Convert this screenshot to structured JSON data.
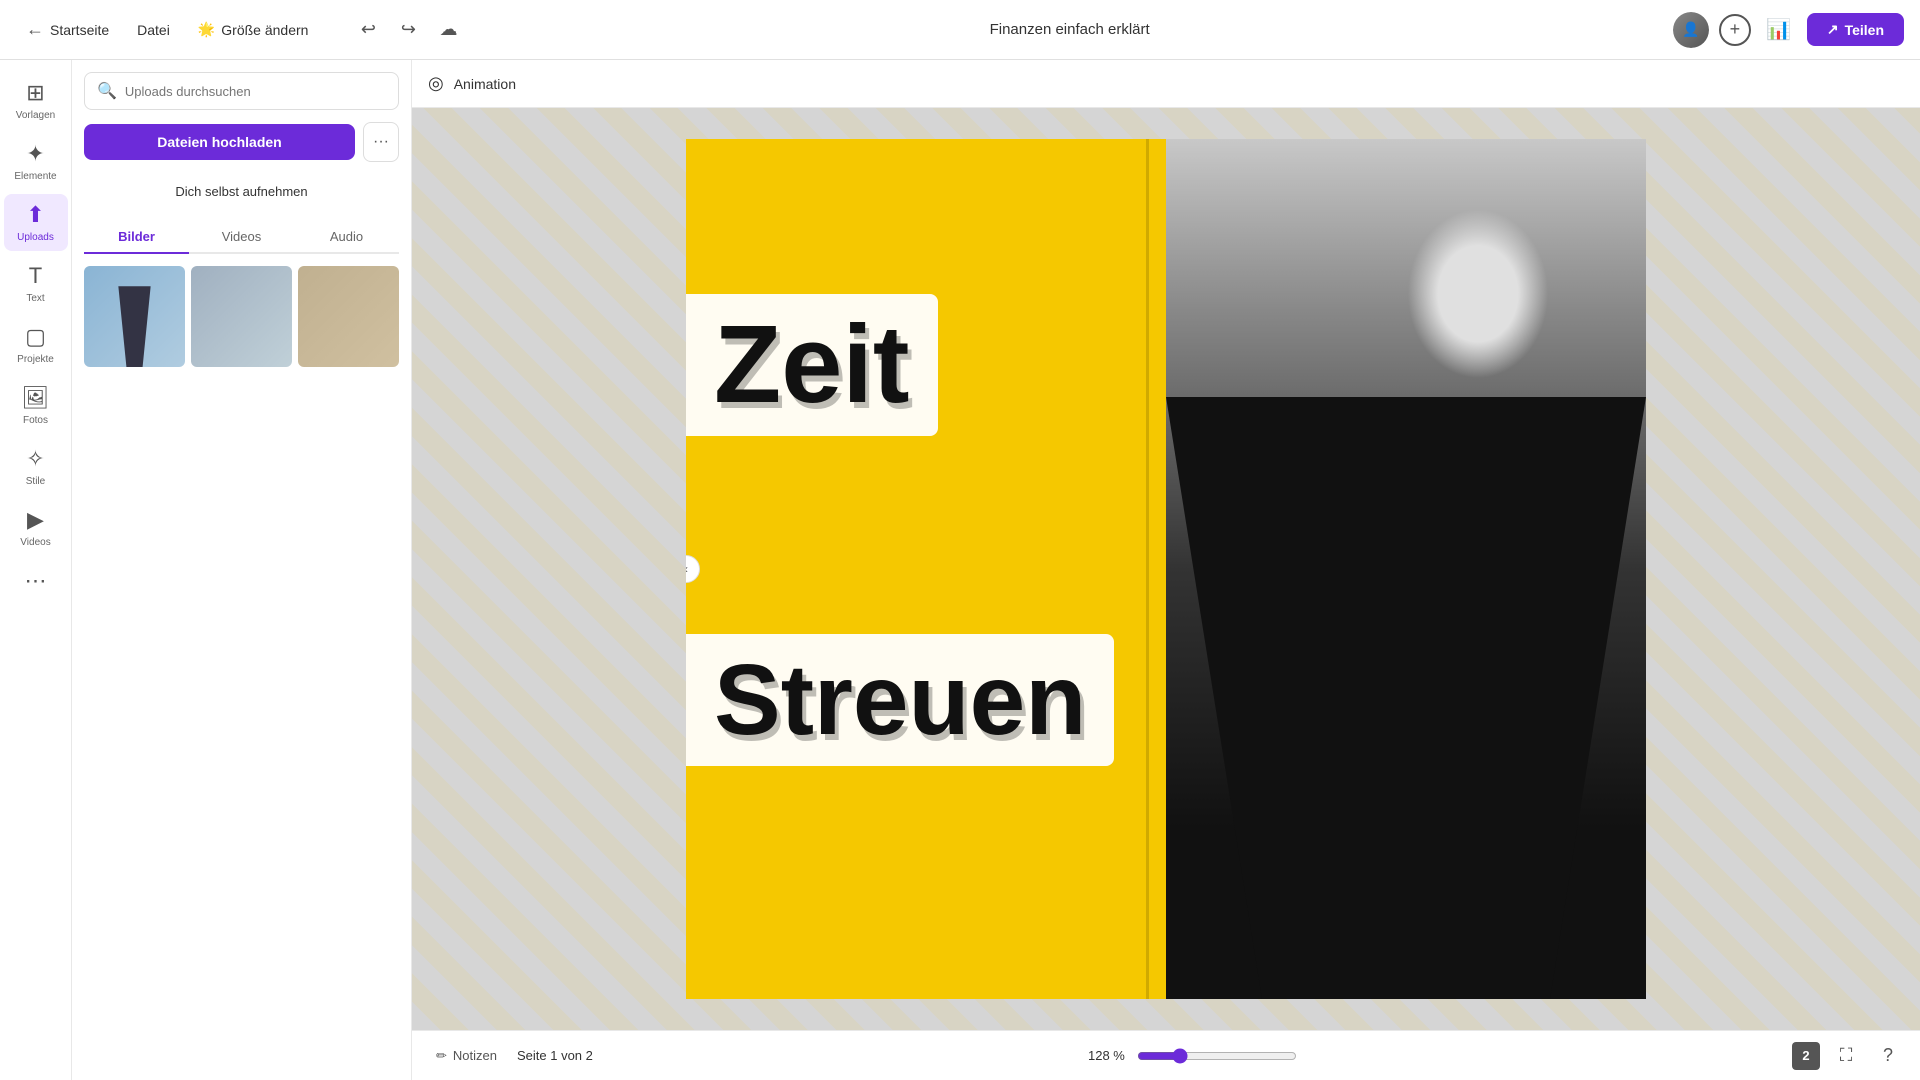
{
  "topbar": {
    "back_label": "Startseite",
    "file_label": "Datei",
    "resize_label": "Größe ändern",
    "title": "Finanzen einfach erklärt",
    "share_label": "Teilen"
  },
  "sidebar": {
    "items": [
      {
        "id": "vorlagen",
        "label": "Vorlagen",
        "icon": "⊞"
      },
      {
        "id": "elemente",
        "label": "Elemente",
        "icon": "✦"
      },
      {
        "id": "uploads",
        "label": "Uploads",
        "icon": "⬆",
        "active": true
      },
      {
        "id": "text",
        "label": "Text",
        "icon": "T"
      },
      {
        "id": "projekte",
        "label": "Projekte",
        "icon": "▢"
      },
      {
        "id": "fotos",
        "label": "Fotos",
        "icon": "🖼"
      },
      {
        "id": "stile",
        "label": "Stile",
        "icon": "✧"
      },
      {
        "id": "videos",
        "label": "Videos",
        "icon": "▶"
      },
      {
        "id": "more",
        "label": "",
        "icon": "≡"
      }
    ]
  },
  "uploads_panel": {
    "search_placeholder": "Uploads durchsuchen",
    "upload_btn": "Dateien hochladen",
    "selfie_btn": "Dich selbst aufnehmen",
    "tabs": [
      {
        "id": "bilder",
        "label": "Bilder",
        "active": true
      },
      {
        "id": "videos",
        "label": "Videos"
      },
      {
        "id": "audio",
        "label": "Audio"
      }
    ]
  },
  "animation_bar": {
    "label": "Animation"
  },
  "canvas": {
    "text_zeit": "Zeit",
    "text_streuven": "Streuen"
  },
  "bottom_bar": {
    "notizen_label": "Notizen",
    "page_info": "Seite 1 von 2",
    "zoom_percent": "128 %",
    "page_count": "2",
    "zoom_value": 128,
    "zoom_min": 10,
    "zoom_max": 500
  }
}
